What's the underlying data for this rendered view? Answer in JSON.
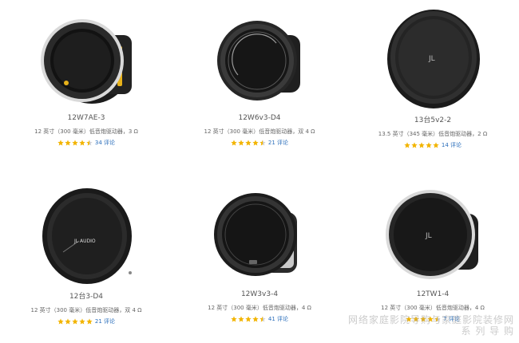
{
  "products": [
    {
      "name": "12W7AE-3",
      "desc": "12 英寸（300 毫米）低音炮驱动器，3 Ω",
      "stars": 4.5,
      "reviews": "34",
      "review_suffix": "评论"
    },
    {
      "name": "12W6v3-D4",
      "desc": "12 英寸（300 毫米）低音炮驱动器，双 4 Ω",
      "stars": 4.5,
      "reviews": "21",
      "review_suffix": "评论"
    },
    {
      "name": "13台5v2-2",
      "desc": "13.5 英寸（345 毫米）低音炮驱动器，2 Ω",
      "stars": 5,
      "reviews": "14",
      "review_suffix": "评论"
    },
    {
      "name": "12台3-D4",
      "desc": "12 英寸（300 毫米）低音炮驱动器，双 4 Ω",
      "stars": 5,
      "reviews": "21",
      "review_suffix": "评论"
    },
    {
      "name": "12W3v3-4",
      "desc": "12 英寸（300 毫米）低音炮驱动器，4 Ω",
      "stars": 4.5,
      "reviews": "41",
      "review_suffix": "评论"
    },
    {
      "name": "12TW1-4",
      "desc": "12 英寸（300 毫米）低音炮驱动器，4 Ω",
      "stars": 4.5,
      "reviews": "7",
      "review_suffix": "评论"
    }
  ],
  "watermark": {
    "line1": "网络家庭影院导购与家庭影院装修网",
    "line2": "系 列 导 购"
  },
  "colors": {
    "star": "#f2b400",
    "link": "#2a6ebb",
    "accent_yellow": "#e8b21a"
  }
}
